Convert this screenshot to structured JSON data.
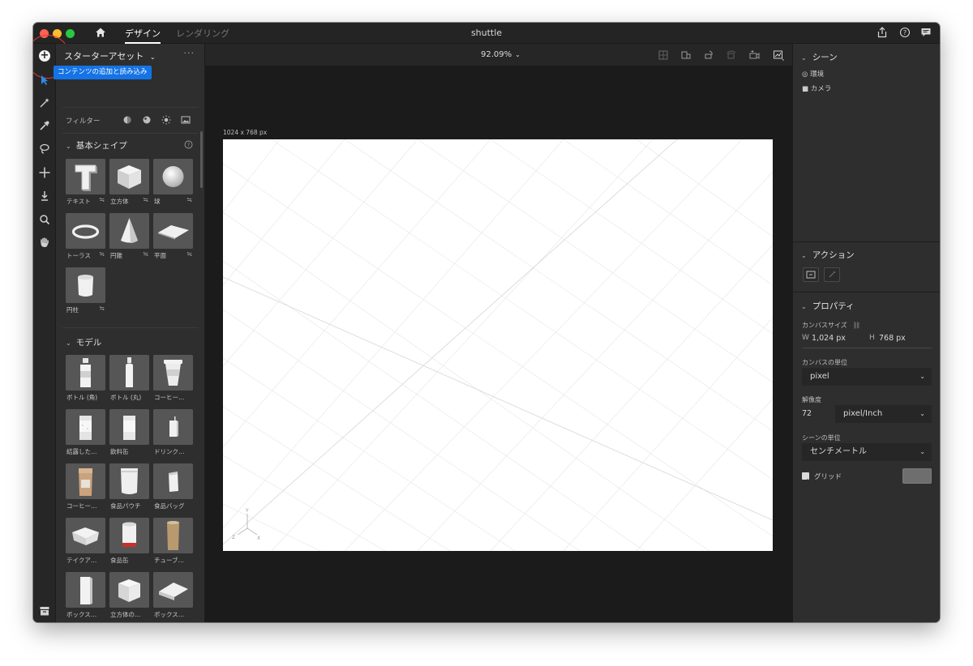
{
  "titlebar": {
    "tabs": [
      {
        "label": "デザイン",
        "active": true
      },
      {
        "label": "レンダリング",
        "active": false
      }
    ],
    "title": "shuttle",
    "icons": [
      "share-icon",
      "help-icon",
      "feedback-icon"
    ]
  },
  "toolbar": {
    "add_tooltip": "コンテンツの追加と読み込み",
    "tools": [
      "select-tool-icon",
      "magic-wand-icon",
      "eyedropper-icon",
      "lasso-icon",
      "move-icon",
      "drop-icon",
      "zoom-icon",
      "hand-icon"
    ],
    "bottom_icon": "library-icon"
  },
  "left_panel": {
    "header": "スターターアセット",
    "more": "···",
    "filter_label": "フィルター",
    "filter_icons": [
      "model-filter-icon",
      "material-filter-icon",
      "light-filter-icon",
      "image-filter-icon"
    ],
    "basic_shapes": {
      "title": "基本シェイプ",
      "items": [
        {
          "label": "テキスト",
          "variants": "≒",
          "shape": "text"
        },
        {
          "label": "立方体",
          "variants": "≒",
          "shape": "cube"
        },
        {
          "label": "球",
          "variants": "≒",
          "shape": "sphere"
        },
        {
          "label": "トーラス",
          "variants": "≒",
          "shape": "torus"
        },
        {
          "label": "円錐",
          "variants": "≒",
          "shape": "cone"
        },
        {
          "label": "平面",
          "variants": "≒",
          "shape": "plane"
        },
        {
          "label": "円柱",
          "variants": "≒",
          "shape": "cylinder"
        }
      ]
    },
    "models": {
      "title": "モデル",
      "items": [
        {
          "label": "ボトル (角)",
          "shape": "bottle-square"
        },
        {
          "label": "ボトル (丸)",
          "shape": "bottle-round"
        },
        {
          "label": "コーヒー…",
          "shape": "coffee-cup"
        },
        {
          "label": "結露した…",
          "shape": "can-condensed"
        },
        {
          "label": "飲料缶",
          "shape": "can"
        },
        {
          "label": "ドリンク…",
          "shape": "drink-box"
        },
        {
          "label": "コーヒー…",
          "shape": "coffee-bag"
        },
        {
          "label": "食品パウチ",
          "shape": "pouch"
        },
        {
          "label": "食品バッグ",
          "shape": "food-bag"
        },
        {
          "label": "テイクア…",
          "shape": "takeout"
        },
        {
          "label": "食品缶",
          "shape": "food-can"
        },
        {
          "label": "チューブ…",
          "shape": "tube"
        },
        {
          "label": "ボックス…",
          "shape": "tall-box"
        },
        {
          "label": "立方体の…",
          "shape": "cube-box"
        },
        {
          "label": "ボックス…",
          "shape": "flat-box"
        }
      ]
    }
  },
  "canvas": {
    "zoom": "92.09%",
    "size_label": "1024 x 768 px",
    "toolbar_icons": [
      "frame-icon",
      "camera-view-icon",
      "rotate-camera-icon",
      "orbit-icon",
      "bookmark-camera-icon",
      "render-preview-icon"
    ]
  },
  "right_panel": {
    "scene": {
      "title": "シーン",
      "items": [
        {
          "label": "環境",
          "icon": "environment-icon"
        },
        {
          "label": "カメラ",
          "icon": "camera-icon"
        }
      ]
    },
    "actions": {
      "title": "アクション"
    },
    "properties": {
      "title": "プロパティ",
      "canvas_size_label": "カンバスサイズ",
      "w_label": "W",
      "w_value": "1,024 px",
      "h_label": "H",
      "h_value": "768 px",
      "canvas_unit_label": "カンバスの単位",
      "canvas_unit_value": "pixel",
      "resolution_label": "解像度",
      "resolution_value": "72",
      "resolution_unit": "pixel/Inch",
      "scene_unit_label": "シーンの単位",
      "scene_unit_value": "センチメートル",
      "grid_label": "グリッド",
      "grid_checked": true,
      "grid_color": "#6e6e6e"
    }
  },
  "colors": {
    "accent": "#1473e6",
    "highlight_ring": "#e33b2e"
  }
}
